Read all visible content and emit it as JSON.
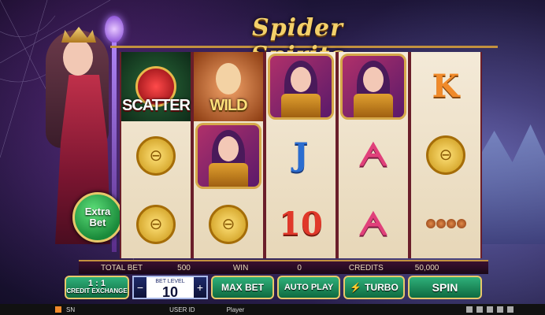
{
  "game": {
    "title": "Spider Spirits",
    "extra_bet_label": "Extra\nBet"
  },
  "reels": [
    [
      "scatter",
      "coin",
      "coin"
    ],
    [
      "wild",
      "portrait",
      "coin"
    ],
    [
      "portrait",
      "J",
      "10"
    ],
    [
      "portrait",
      "A",
      "A"
    ],
    [
      "K",
      "coin",
      "beads"
    ]
  ],
  "symbol_labels": {
    "scatter": "SCATTER",
    "wild": "WILD",
    "J": "J",
    "10": "10",
    "A": "ᗅ",
    "K": "K"
  },
  "status_bar": {
    "total_bet_label": "TOTAL BET",
    "total_bet_value": "500",
    "win_label": "WIN",
    "win_value": "0",
    "credits_label": "CREDITS",
    "credits_value": "50,000"
  },
  "controls": {
    "credit_ratio": "1 : 1",
    "credit_exchange_label": "CREDIT EXCHANGE",
    "bet_level_caption": "BET LEVEL",
    "bet_level_value": "10",
    "minus_label": "−",
    "plus_label": "+",
    "max_bet_label": "MAX BET",
    "auto_play_label": "AUTO PLAY",
    "turbo_label": "TURBO",
    "spin_label": "SPIN"
  },
  "footer": {
    "sn_label": "SN",
    "user_id_label": "USER ID",
    "player_label": "Player"
  },
  "colors": {
    "frame_gold": "#c2913f",
    "button_green": "#2fb07a",
    "reel_bg": "#f4ead8"
  }
}
